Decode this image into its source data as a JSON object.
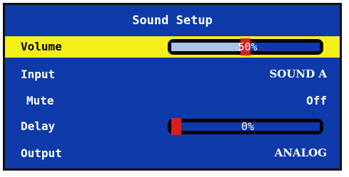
{
  "menu": {
    "title": "Sound Setup",
    "items": [
      {
        "label": "Volume",
        "type": "slider",
        "level_percent": 50,
        "display": "50%",
        "selected": true
      },
      {
        "label": "Input",
        "type": "value",
        "value": "SOUND A"
      },
      {
        "label": "Mute",
        "type": "value",
        "value": "Off"
      },
      {
        "label": "Delay",
        "type": "slider",
        "level_percent": 0,
        "display": "0%"
      },
      {
        "label": "Output",
        "type": "value",
        "value": "ANALOG"
      }
    ]
  },
  "colors": {
    "panel_background": "#0e3aa9",
    "selection_highlight": "#f7ef19",
    "slider_fill": "#a8c4e6",
    "slider_marker": "#d42020",
    "text": "#ffffff"
  }
}
